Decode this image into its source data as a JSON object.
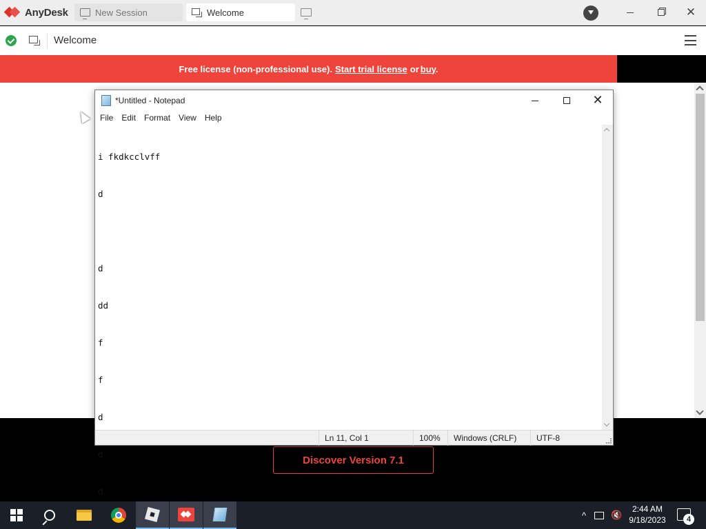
{
  "anydesk": {
    "app_name": "AnyDesk",
    "tabs": [
      {
        "label": "New Session"
      },
      {
        "label": "Welcome"
      }
    ],
    "toolbar_title": "Welcome",
    "license_banner": {
      "text_before": "Free license (non-professional use).",
      "trial_link": "Start trial license",
      "or": "or",
      "buy_link": "buy",
      "period": "."
    },
    "discover_button": "Discover Version 7.1",
    "colors": {
      "brand_red": "#ef443b",
      "connected_green": "#2ea44f"
    }
  },
  "notepad": {
    "title": "*Untitled - Notepad",
    "menu": [
      "File",
      "Edit",
      "Format",
      "View",
      "Help"
    ],
    "lines": [
      "i fkdkcclvff",
      "d",
      "",
      "d",
      "dd",
      "f",
      "f",
      "d",
      "d",
      "d",
      ""
    ],
    "status": {
      "position": "Ln 11, Col 1",
      "zoom": "100%",
      "line_endings": "Windows (CRLF)",
      "encoding": "UTF-8"
    }
  },
  "taskbar": {
    "items": [
      "start-icon",
      "search-icon",
      "file-explorer-icon",
      "chrome-icon",
      "roblox-icon",
      "anydesk-icon",
      "notepad-icon"
    ],
    "time": "2:44 AM",
    "date": "9/18/2023",
    "notification_count": "4"
  }
}
